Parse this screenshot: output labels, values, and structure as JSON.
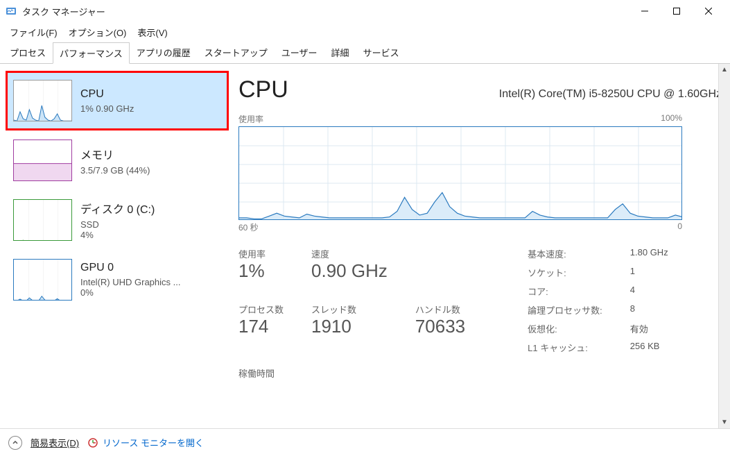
{
  "window": {
    "title": "タスク マネージャー"
  },
  "menu": {
    "file": "ファイル(F)",
    "options": "オプション(O)",
    "view": "表示(V)"
  },
  "tabs": {
    "processes": "プロセス",
    "performance": "パフォーマンス",
    "app_history": "アプリの履歴",
    "startup": "スタートアップ",
    "users": "ユーザー",
    "details": "詳細",
    "services": "サービス"
  },
  "sidebar": {
    "cpu": {
      "title": "CPU",
      "sub": "1%  0.90 GHz"
    },
    "memory": {
      "title": "メモリ",
      "sub": "3.5/7.9 GB (44%)"
    },
    "disk": {
      "title": "ディスク 0 (C:)",
      "sub1": "SSD",
      "sub2": "4%"
    },
    "gpu": {
      "title": "GPU 0",
      "sub1": "Intel(R) UHD Graphics ...",
      "sub2": "0%"
    }
  },
  "detail": {
    "title": "CPU",
    "model": "Intel(R) Core(TM) i5-8250U CPU @ 1.60GHz",
    "chart_label_left": "使用率",
    "chart_label_right": "100%",
    "chart_bottom_left": "60 秒",
    "chart_bottom_right": "0"
  },
  "stats": {
    "usage_label": "使用率",
    "usage_value": "1%",
    "speed_label": "速度",
    "speed_value": "0.90 GHz",
    "processes_label": "プロセス数",
    "processes_value": "174",
    "threads_label": "スレッド数",
    "threads_value": "1910",
    "handles_label": "ハンドル数",
    "handles_value": "70633",
    "uptime_label": "稼働時間"
  },
  "stats_right": {
    "base_speed_label": "基本速度:",
    "base_speed_value": "1.80 GHz",
    "sockets_label": "ソケット:",
    "sockets_value": "1",
    "cores_label": "コア:",
    "cores_value": "4",
    "logical_label": "論理プロセッサ数:",
    "logical_value": "8",
    "virt_label": "仮想化:",
    "virt_value": "有効",
    "l1_label": "L1 キャッシュ:",
    "l1_value": "256 KB"
  },
  "footer": {
    "fewer": "簡易表示(D)",
    "resmon": "リソース モニターを開く"
  },
  "chart_data": {
    "type": "line",
    "title": "CPU 使用率",
    "xlabel": "60 秒 → 0",
    "ylabel": "%",
    "ylim": [
      0,
      100
    ],
    "x": [
      0,
      1,
      2,
      3,
      4,
      5,
      6,
      7,
      8,
      9,
      10,
      11,
      12,
      13,
      14,
      15,
      16,
      17,
      18,
      19,
      20,
      21,
      22,
      23,
      24,
      25,
      26,
      27,
      28,
      29,
      30,
      31,
      32,
      33,
      34,
      35,
      36,
      37,
      38,
      39,
      40,
      41,
      42,
      43,
      44,
      45,
      46,
      47,
      48,
      49,
      50,
      51,
      52,
      53,
      54,
      55,
      56,
      57,
      58,
      59
    ],
    "values": [
      3,
      3,
      2,
      2,
      5,
      8,
      5,
      4,
      3,
      7,
      5,
      4,
      3,
      3,
      3,
      3,
      3,
      3,
      3,
      3,
      4,
      10,
      25,
      12,
      6,
      8,
      20,
      30,
      15,
      8,
      5,
      4,
      3,
      3,
      3,
      3,
      3,
      3,
      3,
      10,
      6,
      4,
      3,
      3,
      3,
      3,
      3,
      3,
      3,
      3,
      12,
      18,
      8,
      5,
      4,
      3,
      3,
      3,
      6,
      4
    ]
  },
  "sidebar_charts": {
    "cpu_values": [
      5,
      3,
      25,
      8,
      5,
      30,
      10,
      5,
      3,
      40,
      12,
      5,
      3,
      8,
      20,
      5,
      3,
      3,
      3,
      3
    ],
    "memory_pct": 44,
    "disk_values": [
      2,
      1,
      1,
      3,
      1,
      1,
      2,
      1,
      1,
      1,
      1,
      1,
      1,
      1,
      1,
      1,
      1,
      1,
      1,
      1
    ],
    "gpu_values": [
      1,
      1,
      5,
      1,
      1,
      8,
      2,
      1,
      1,
      12,
      3,
      1,
      1,
      1,
      6,
      1,
      1,
      1,
      1,
      1
    ]
  }
}
